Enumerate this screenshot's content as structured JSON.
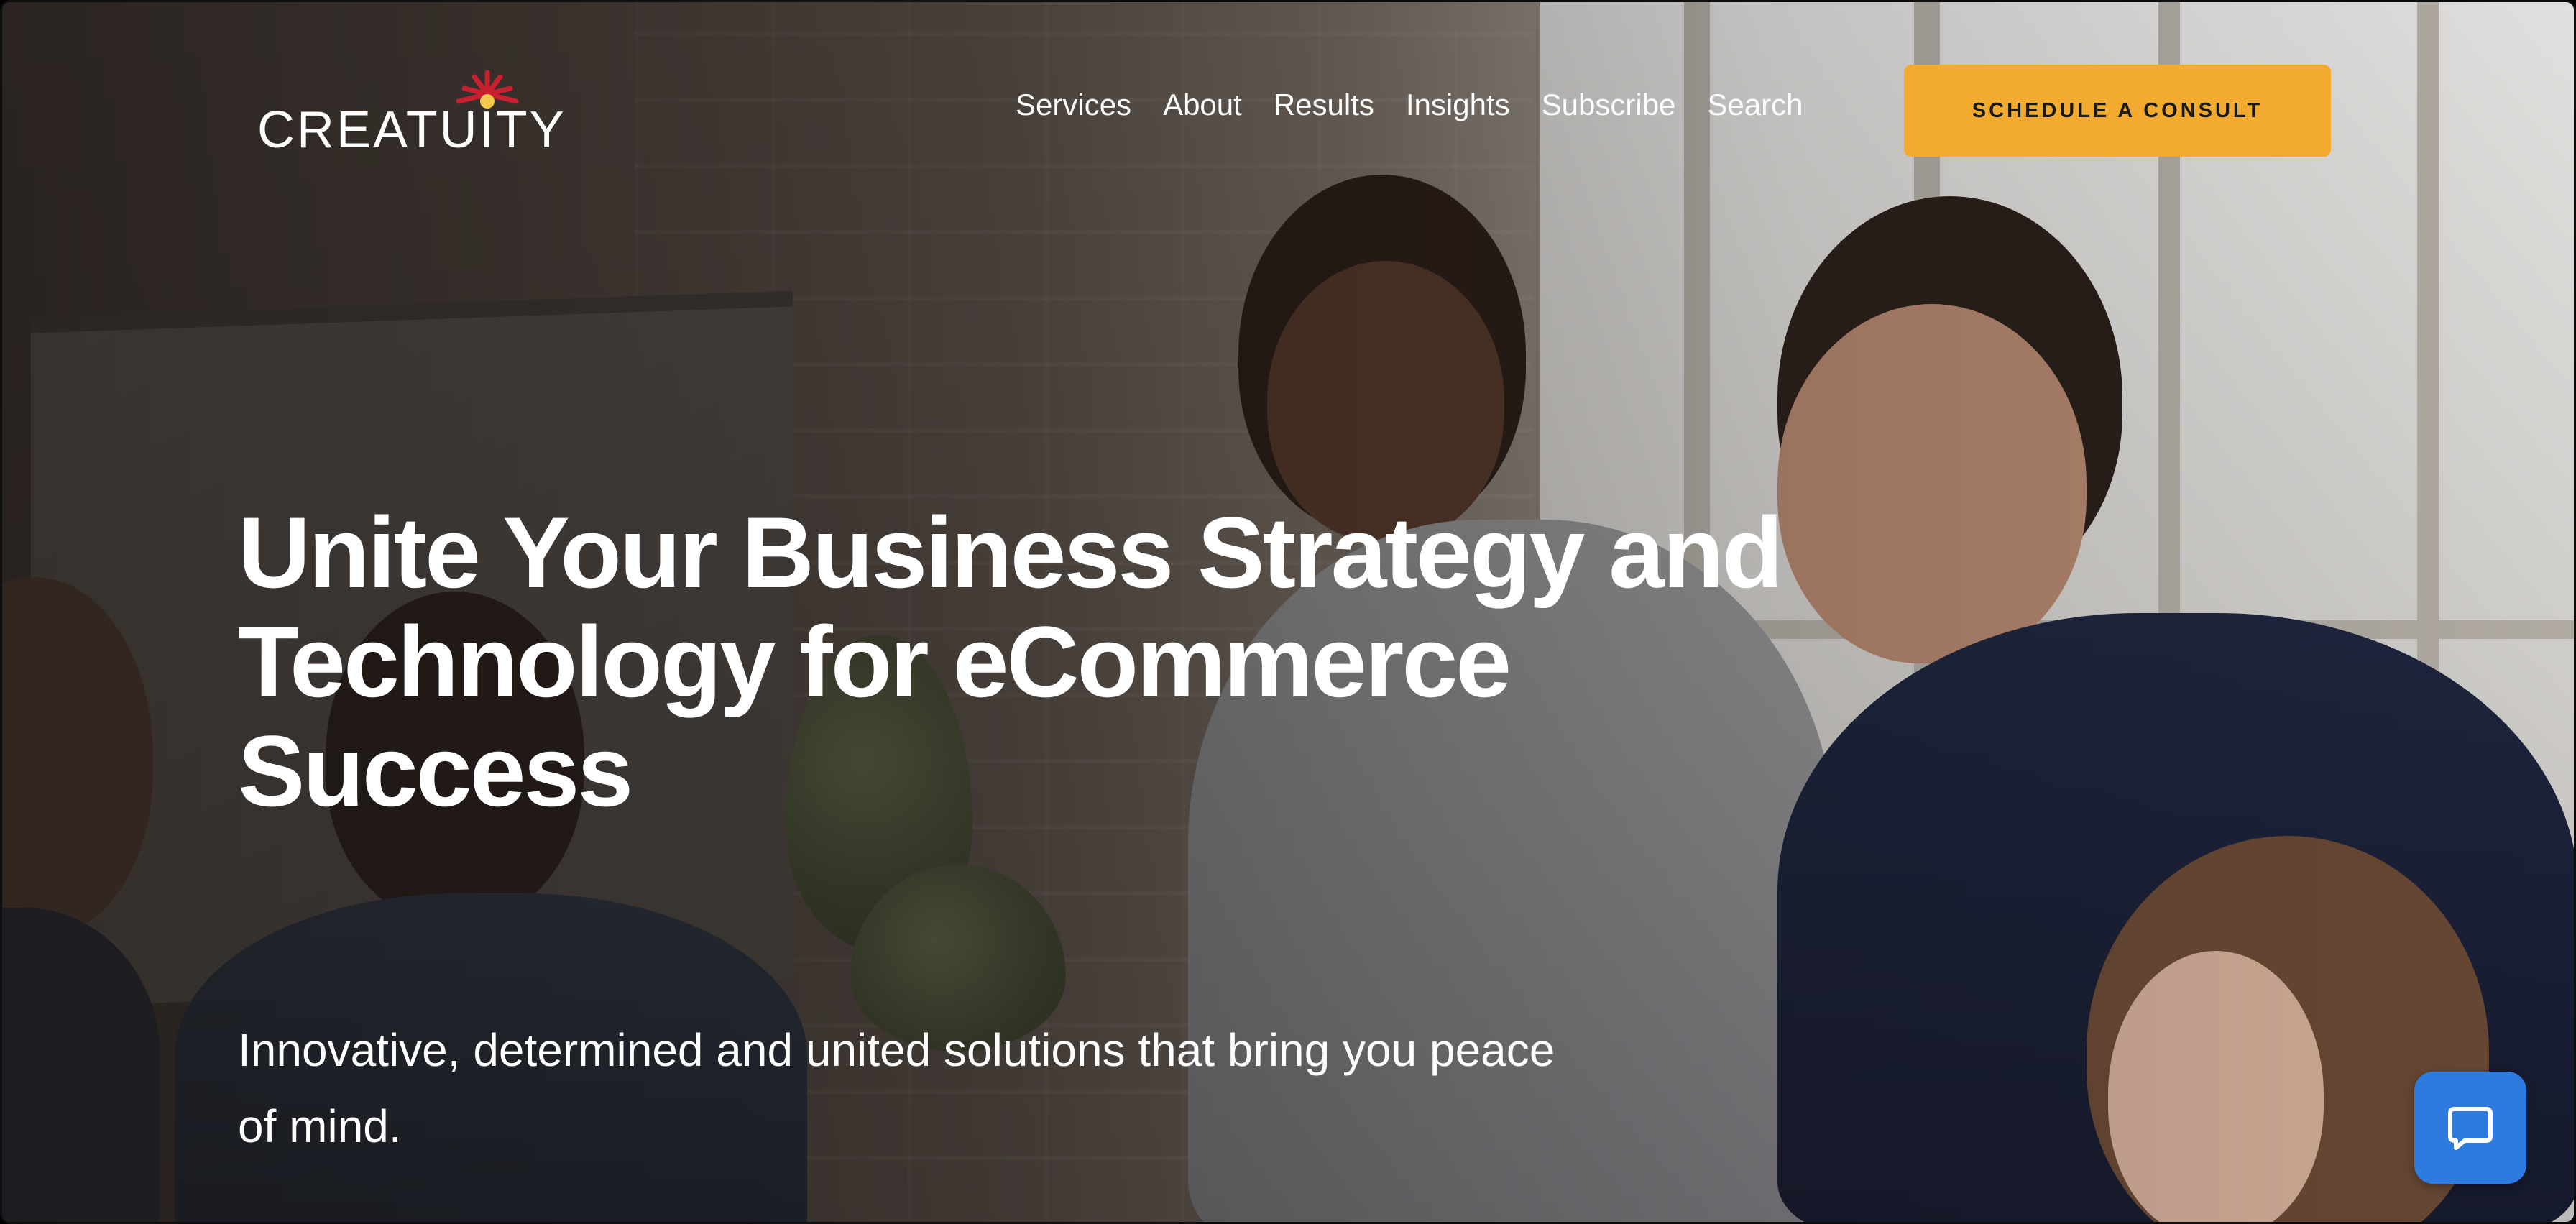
{
  "brand": {
    "name": "CREATUITY",
    "colors": {
      "logo_red": "#c8202f",
      "logo_yellow": "#f2c94c",
      "cta": "#f2ab2e",
      "chat": "#2e7be0"
    }
  },
  "nav": {
    "items": [
      {
        "label": "Services"
      },
      {
        "label": "About"
      },
      {
        "label": "Results"
      },
      {
        "label": "Insights"
      },
      {
        "label": "Subscribe"
      },
      {
        "label": "Search"
      }
    ],
    "cta_label": "SCHEDULE A CONSULT"
  },
  "hero": {
    "headline_line1": "Unite Your Business Strategy and",
    "headline_line2": "Technology for eCommerce",
    "headline_line3": "Success",
    "subhead_line1": "Innovative, determined and united solutions that bring you peace",
    "subhead_line2": "of mind."
  },
  "chat": {
    "icon": "chat-bubble-icon"
  }
}
